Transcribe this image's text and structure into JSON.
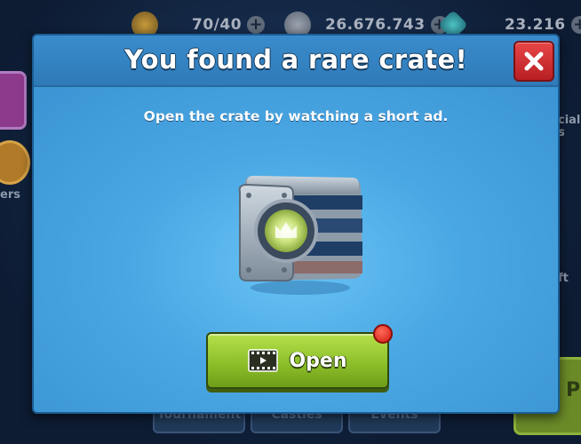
{
  "background": {
    "resources": [
      {
        "icon": "energy-icon",
        "value": "70/40"
      },
      {
        "icon": "coin-icon",
        "value": "26.676.743"
      },
      {
        "icon": "gem-icon",
        "value": "23.216"
      }
    ],
    "side_labels": [
      "ers",
      "cial",
      "s",
      "ft"
    ],
    "bottom_tabs": [
      "Tournament",
      "Castles",
      "Events"
    ],
    "right_button_label": "Pl"
  },
  "modal": {
    "title": "You found a rare crate!",
    "subtitle": "Open the crate by watching a short ad.",
    "open_button_label": "Open",
    "accent_color": "#3e9ad8",
    "button_color": "#8dc02a",
    "close_color": "#d12a2e"
  }
}
